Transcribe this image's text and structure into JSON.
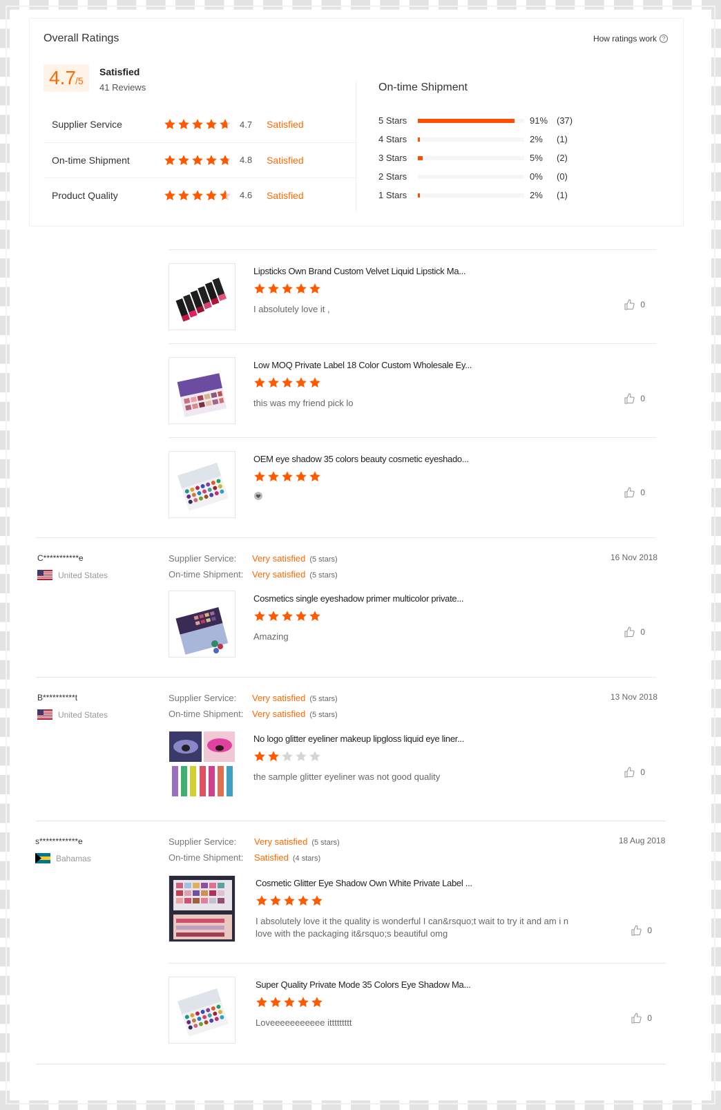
{
  "overall": {
    "title": "Overall Ratings",
    "how_link": "How ratings work",
    "score": "4.7",
    "score_denominator": "/5",
    "score_word": "Satisfied",
    "reviews_count": "41 Reviews",
    "metrics": [
      {
        "label": "Supplier Service",
        "value": "4.7",
        "word": "Satisfied",
        "stars": 4.7
      },
      {
        "label": "On-time Shipment",
        "value": "4.8",
        "word": "Satisfied",
        "stars": 4.8
      },
      {
        "label": "Product Quality",
        "value": "4.6",
        "word": "Satisfied",
        "stars": 4.6
      }
    ]
  },
  "shipment": {
    "title": "On-time Shipment",
    "rows": [
      {
        "label": "5 Stars",
        "pct": "91%",
        "count": "(37)",
        "fraction": 0.91
      },
      {
        "label": "4 Stars",
        "pct": "2%",
        "count": "(1)",
        "fraction": 0.02
      },
      {
        "label": "3 Stars",
        "pct": "5%",
        "count": "(2)",
        "fraction": 0.05
      },
      {
        "label": "2 Stars",
        "pct": "0%",
        "count": "(0)",
        "fraction": 0
      },
      {
        "label": "1 Stars",
        "pct": "2%",
        "count": "(1)",
        "fraction": 0.02
      }
    ]
  },
  "colors": {
    "accent": "#ff6a00",
    "bar": "#ff4e00",
    "star_off": "#d6d6d6"
  },
  "group0": {
    "products": [
      {
        "title": "Lipsticks Own Brand Custom Velvet Liquid Lipstick Ma...",
        "stars": 5,
        "text": "I absolutely love it ,",
        "likes": "0"
      },
      {
        "title": "Low MOQ Private Label 18 Color Custom Wholesale Ey...",
        "stars": 5,
        "text": "this was my friend pick lo",
        "likes": "0"
      },
      {
        "title": "OEM eye shadow 35 colors beauty cosmetic eyeshado...",
        "stars": 5,
        "text": "",
        "likes": "0"
      }
    ]
  },
  "reviews": [
    {
      "name": "C***********e",
      "country": "United States",
      "date": "16 Nov 2018",
      "service_label": "Supplier Service:",
      "service_value": "Very satisfied",
      "service_stars": "(5 stars)",
      "shipment_label": "On-time Shipment:",
      "shipment_value": "Very satisfied",
      "shipment_stars": "(5 stars)",
      "products": [
        {
          "title": "Cosmetics single eyeshadow primer multicolor private...",
          "stars": 5,
          "text": "Amazing",
          "likes": "0"
        }
      ]
    },
    {
      "name": "B**********t",
      "country": "United States",
      "date": "13 Nov 2018",
      "service_label": "Supplier Service:",
      "service_value": "Very satisfied",
      "service_stars": "(5 stars)",
      "shipment_label": "On-time Shipment:",
      "shipment_value": "Very satisfied",
      "shipment_stars": "(5 stars)",
      "products": [
        {
          "title": "No logo glitter eyeliner makeup lipgloss liquid eye liner...",
          "stars": 2,
          "text": "the sample glitter eyeliner was not good quality",
          "likes": "0"
        }
      ]
    },
    {
      "name": "s************e",
      "country": "Bahamas",
      "date": "18 Aug 2018",
      "service_label": "Supplier Service:",
      "service_value": "Very satisfied",
      "service_stars": "(5 stars)",
      "shipment_label": "On-time Shipment:",
      "shipment_value": "Satisfied",
      "shipment_stars": "(4 stars)",
      "products": [
        {
          "title": "Cosmetic Glitter Eye Shadow Own White Private Label ...",
          "stars": 5,
          "text": "I absolutely love it the quality is wonderful I can&rsquo;t wait to try it and am i n love with the packaging it&rsquo;s beautiful omg",
          "likes": "0"
        },
        {
          "title": "Super Quality Private Mode 35 Colors Eye Shadow Ma...",
          "stars": 5,
          "text": "Loveeeeeeeeeee ittttttttt",
          "likes": "0"
        }
      ]
    }
  ]
}
